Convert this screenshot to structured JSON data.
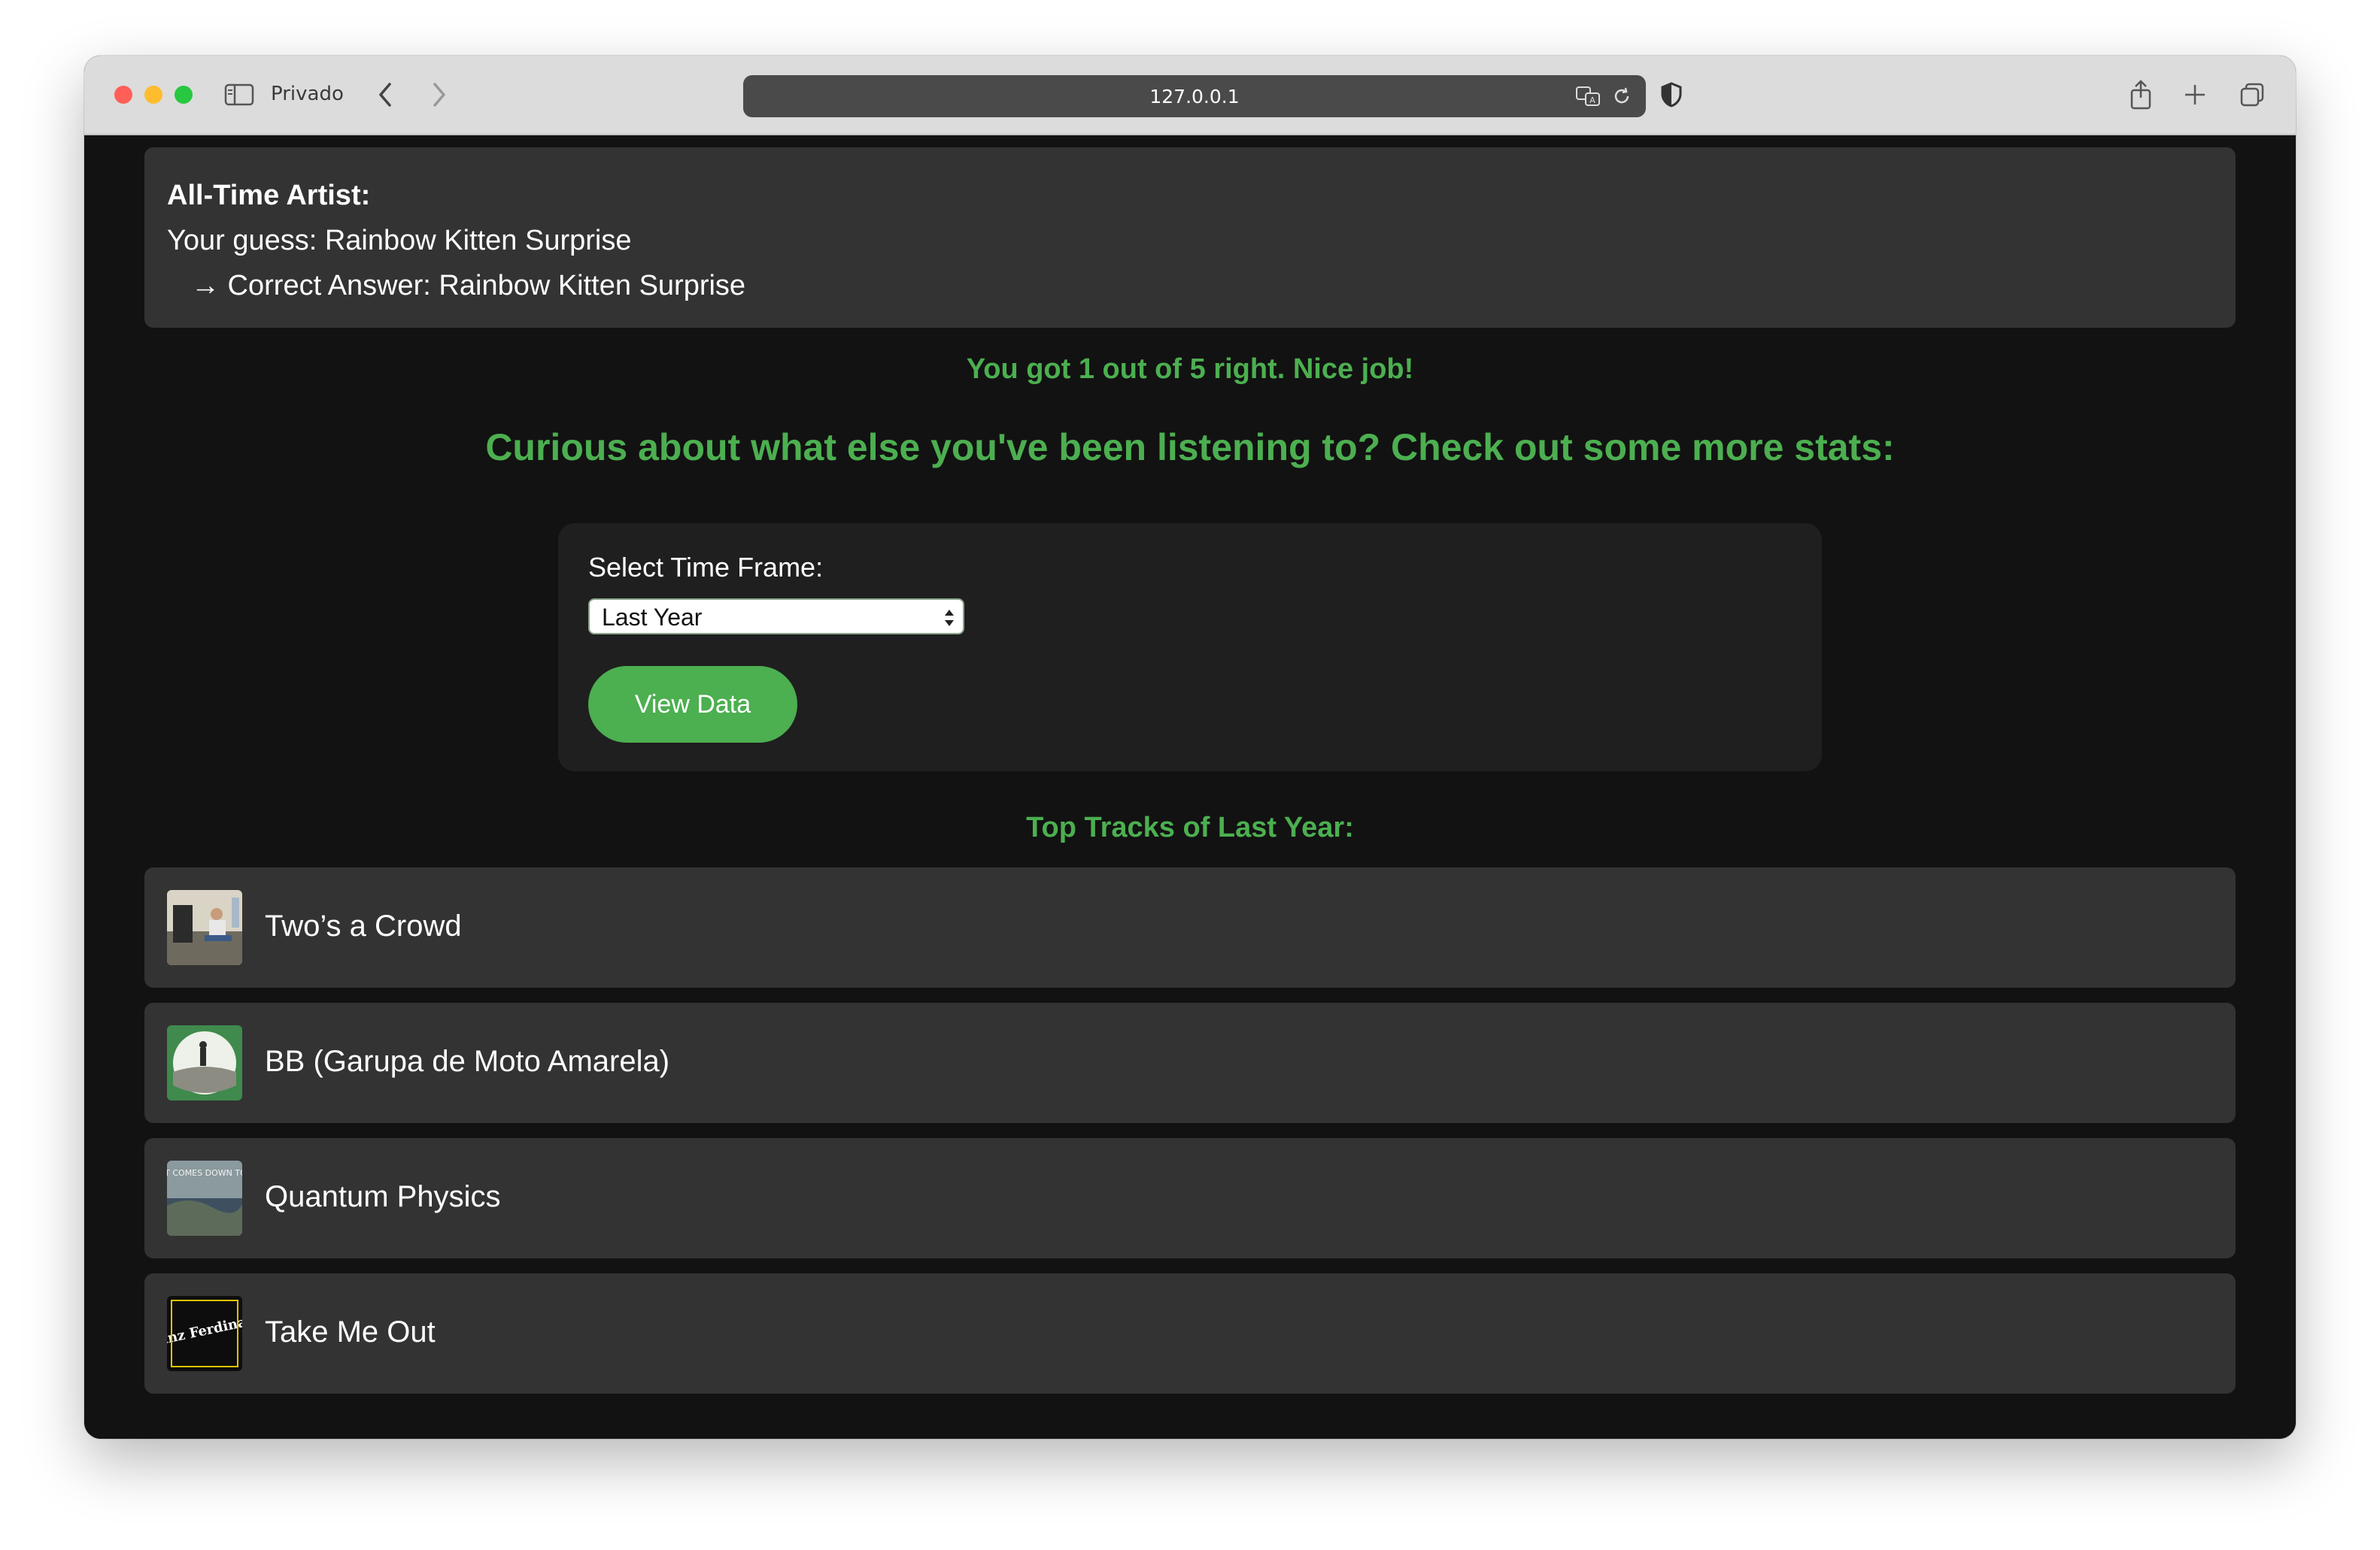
{
  "browser": {
    "private_label": "Privado",
    "url": "127.0.0.1"
  },
  "artist_result": {
    "title": "All-Time Artist:",
    "guess": "Your guess: Rainbow Kitten Surprise",
    "answer": "→ Correct Answer: Rainbow Kitten Surprise"
  },
  "score_text": "You got 1 out of 5 right. Nice job!",
  "curious_text": "Curious about what else you've been listening to? Check out some more stats:",
  "form": {
    "label": "Select Time Frame:",
    "selected": "Last Year",
    "button": "View Data"
  },
  "tracks_title": "Top Tracks of Last Year:",
  "tracks": [
    {
      "name": "Two’s a Crowd",
      "art": "two-s-a-crowd-cover"
    },
    {
      "name": "BB (Garupa de Moto Amarela)",
      "art": "bb-cover"
    },
    {
      "name": "Quantum Physics",
      "art": "quantum-physics-cover",
      "art_text": "IF IT COMES DOWN TO IT"
    },
    {
      "name": "Take Me Out",
      "art": "franz-ferdinand-cover",
      "art_text": "Franz Ferdinand"
    }
  ]
}
